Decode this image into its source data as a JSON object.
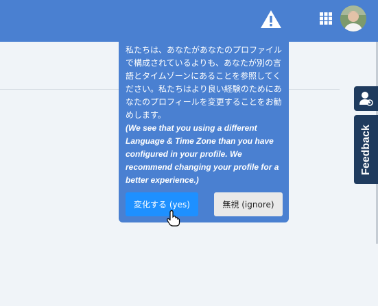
{
  "topbar": {
    "warning_icon": "warning-triangle-icon",
    "apps_icon": "apps-grid-icon",
    "avatar_icon": "user-avatar"
  },
  "side": {
    "icon_tab": "user-settings-icon",
    "feedback_label": "Feedback"
  },
  "popover": {
    "message_jp": "私たちは、あなたがあなたのプロファイルで構成されているよりも、あなたが別の言語とタイムゾーンにあることを参照してください。私たちはより良い経験のためにあなたのプロフィールを変更することをお勧めします。",
    "message_en": "(We see that you using a different Language & Time Zone than you have configured in your profile. We recommend changing your profile for a better experience.)",
    "yes_label": "変化する (yes)",
    "ignore_label": "無視 (ignore)"
  },
  "colors": {
    "topbar": "#4a80d1",
    "popover": "#4a80d1",
    "yes_button": "#1e90ff",
    "ignore_button": "#e9e9e9",
    "feedback_tab": "#1f3b5e",
    "page_bg": "#f0f4f8"
  }
}
